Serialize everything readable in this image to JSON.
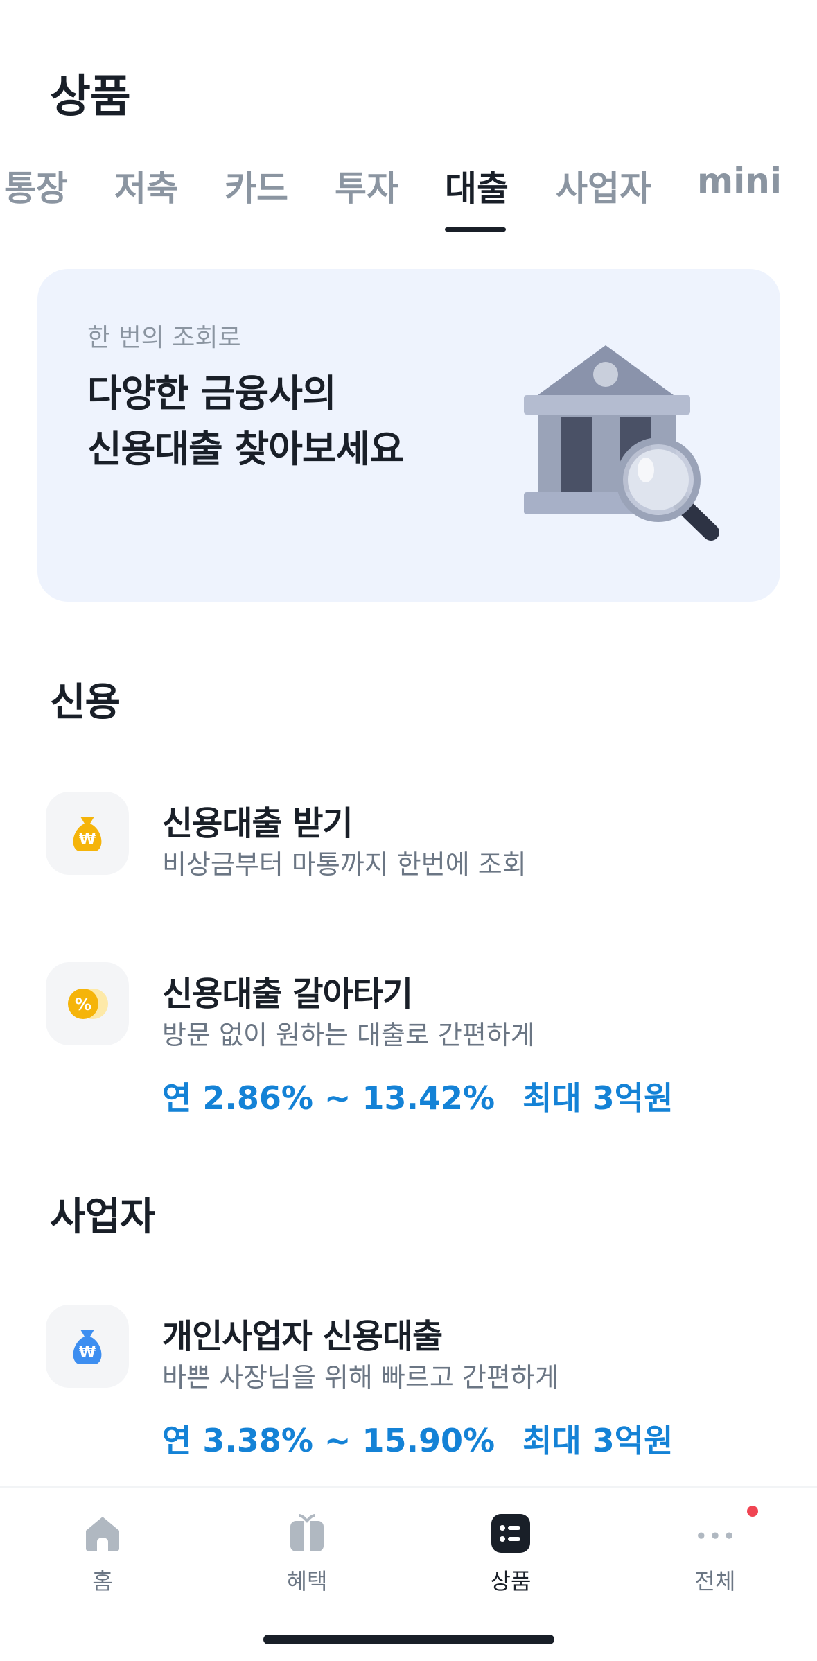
{
  "header": {
    "title": "상품"
  },
  "tabs": [
    {
      "label": "통장"
    },
    {
      "label": "저축"
    },
    {
      "label": "카드"
    },
    {
      "label": "투자"
    },
    {
      "label": "대출"
    },
    {
      "label": "사업자"
    },
    {
      "label": "mini"
    }
  ],
  "active_tab": "대출",
  "banner": {
    "subtitle": "한 번의 조회로",
    "title_line1": "다양한 금융사의",
    "title_line2": "신용대출 찾아보세요",
    "icon": "bank-search-icon"
  },
  "sections": [
    {
      "title": "신용",
      "items": [
        {
          "title": "신용대출 받기",
          "desc": "비상금부터 마통까지 한번에 조회",
          "icon": "money-bag-won-icon"
        },
        {
          "title": "신용대출 갈아타기",
          "desc": "방문 없이 원하는 대출로 간편하게",
          "rate": "연 2.86% ~ 13.42%",
          "limit": "최대 3억원",
          "icon": "percent-coin-icon"
        }
      ]
    },
    {
      "title": "사업자",
      "items": [
        {
          "title": "개인사업자 신용대출",
          "desc": "바쁜 사장님을 위해 빠르고 간편하게",
          "rate": "연 3.38% ~ 15.90%",
          "limit": "최대 3억원",
          "icon": "money-bag-won-icon"
        }
      ]
    }
  ],
  "bottom_nav": [
    {
      "label": "홈",
      "icon": "home-icon"
    },
    {
      "label": "혜택",
      "icon": "gift-icon"
    },
    {
      "label": "상품",
      "icon": "product-list-icon"
    },
    {
      "label": "전체",
      "icon": "more-dots-icon"
    }
  ],
  "colors": {
    "accent": "#1482d6",
    "text": "#191f28",
    "muted": "#8b95a1",
    "banner_bg": "#eef3fd",
    "notification": "#f04452"
  }
}
